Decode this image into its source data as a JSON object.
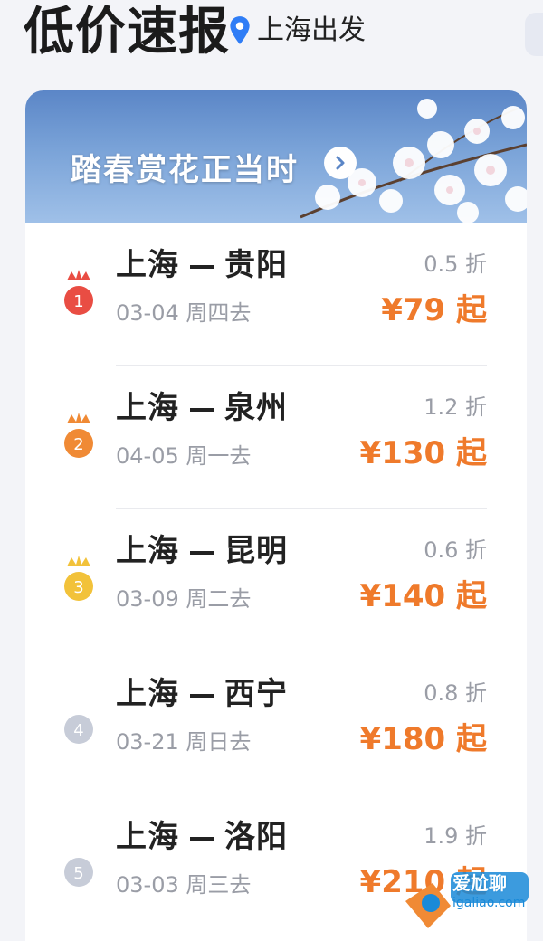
{
  "header": {
    "title": "低价速报",
    "location": "上海出发"
  },
  "banner": {
    "text": "踏春赏花正当时"
  },
  "deals": [
    {
      "rank": "1",
      "from": "上海",
      "to": "贵阳",
      "date": "03-04 周四去",
      "discount": "0.5 折",
      "price": "¥79 起",
      "badge_color": "#e94d43"
    },
    {
      "rank": "2",
      "from": "上海",
      "to": "泉州",
      "date": "04-05 周一去",
      "discount": "1.2 折",
      "price": "¥130 起",
      "badge_color": "#f08a35"
    },
    {
      "rank": "3",
      "from": "上海",
      "to": "昆明",
      "date": "03-09 周二去",
      "discount": "0.6 折",
      "price": "¥140 起",
      "badge_color": "#f2c23a"
    },
    {
      "rank": "4",
      "from": "上海",
      "to": "西宁",
      "date": "03-21 周日去",
      "discount": "0.8 折",
      "price": "¥180 起",
      "badge_color": "#c7ccd8"
    },
    {
      "rank": "5",
      "from": "上海",
      "to": "洛阳",
      "date": "03-03 周三去",
      "discount": "1.9 折",
      "price": "¥210 起",
      "badge_color": "#c7ccd8"
    }
  ],
  "watermark": {
    "text": "爱尬聊",
    "sub": "igaliao.com"
  },
  "colors": {
    "price": "#ef7a2b",
    "pin": "#2f7df6"
  }
}
